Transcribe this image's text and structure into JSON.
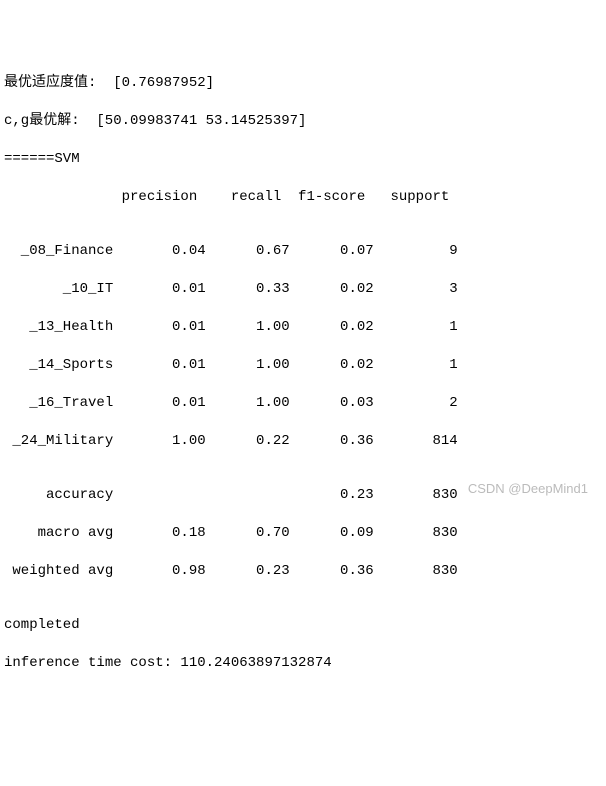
{
  "lines": {
    "fitness": "最优适应度值:  [0.76987952]",
    "cg": "c,g最优解:  [50.09983741 53.14525397]",
    "svm": "======SVM",
    "header": "              precision    recall  f1-score   support",
    "blank": "",
    "r08": "  _08_Finance       0.04      0.67      0.07         9",
    "r10": "       _10_IT       0.01      0.33      0.02         3",
    "r13": "   _13_Health       0.01      1.00      0.02         1",
    "r14": "   _14_Sports       0.01      1.00      0.02         1",
    "r16": "   _16_Travel       0.01      1.00      0.03         2",
    "r24": " _24_Military       1.00      0.22      0.36       814",
    "acc": "     accuracy                           0.23       830",
    "macro": "    macro avg       0.18      0.70      0.09       830",
    "weighted": " weighted avg       0.98      0.23      0.36       830",
    "completed": "completed",
    "time": "inference time cost: 110.24063897132874"
  },
  "chart_data": {
    "type": "table",
    "title": "SVM classification report",
    "best_fitness": 0.76987952,
    "c_g_best": [
      50.09983741,
      53.14525397
    ],
    "columns": [
      "precision",
      "recall",
      "f1-score",
      "support"
    ],
    "rows": [
      {
        "label": "_08_Finance",
        "precision": 0.04,
        "recall": 0.67,
        "f1-score": 0.07,
        "support": 9
      },
      {
        "label": "_10_IT",
        "precision": 0.01,
        "recall": 0.33,
        "f1-score": 0.02,
        "support": 3
      },
      {
        "label": "_13_Health",
        "precision": 0.01,
        "recall": 1.0,
        "f1-score": 0.02,
        "support": 1
      },
      {
        "label": "_14_Sports",
        "precision": 0.01,
        "recall": 1.0,
        "f1-score": 0.02,
        "support": 1
      },
      {
        "label": "_16_Travel",
        "precision": 0.01,
        "recall": 1.0,
        "f1-score": 0.03,
        "support": 2
      },
      {
        "label": "_24_Military",
        "precision": 1.0,
        "recall": 0.22,
        "f1-score": 0.36,
        "support": 814
      }
    ],
    "summary": {
      "accuracy": {
        "f1-score": 0.23,
        "support": 830
      },
      "macro avg": {
        "precision": 0.18,
        "recall": 0.7,
        "f1-score": 0.09,
        "support": 830
      },
      "weighted avg": {
        "precision": 0.98,
        "recall": 0.23,
        "f1-score": 0.36,
        "support": 830
      }
    },
    "completed": true,
    "inference_time_cost": 110.24063897132874
  },
  "watermark": "CSDN @DeepMind1"
}
